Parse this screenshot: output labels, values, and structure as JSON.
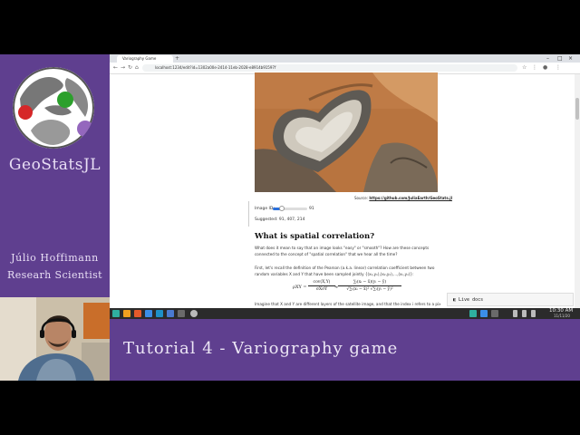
{
  "sidebar": {
    "brand": "GeoStatsJL",
    "presenter_name": "Júlio Hoffimann",
    "presenter_role": "Researh Scientist",
    "logo_colors": {
      "red": "#d62728",
      "green": "#2ca02c",
      "purple": "#9467bd"
    }
  },
  "footer": {
    "title": "Tutorial 4 - Variography game"
  },
  "browser": {
    "tab_label": "Variography Game",
    "url": "localhost:1234/edit?id=1302a00e-2414-11eb-2028-e8914b91597f",
    "window_controls": [
      "–",
      "□",
      "×"
    ],
    "new_tab_label": "+",
    "nav_icons": [
      "back-icon",
      "forward-icon",
      "reload-icon",
      "home-icon"
    ]
  },
  "page": {
    "source_prefix": "Source:",
    "source_link": "https://github.com/JuliaEarth/GeoStats.jl",
    "slider_label": "Image ID:",
    "slider_value": "91",
    "slider_level": 0.25,
    "suggested": "Suggested: 91, 407, 214",
    "heading": "What is spatial correlation?",
    "para1": "What does it mean to say that an image looks \"easy\" or \"smooth\"? How are these concepts connected to the concept of \"spatial correlation\" that we hear all the time?",
    "para2": "First, let's recall the definition of the Pearson (a.k.a. linear) correlation coefficient between two random variables X and Y that have been sampled jointly {(x₁,y₁),(x₂,y₂),…,(xₙ,yₙ)}:",
    "formula_lhs": "ρXY =",
    "formula_mid_num": "cov(X,Y)",
    "formula_mid_den": "σXσY",
    "formula_eq": "≈",
    "formula_rhs_num": "∑ᵢ(xᵢ − x̄)(yᵢ − ȳ)",
    "formula_rhs_den": "√∑ᵢ(xᵢ − x̄)² √∑ᵢ(yᵢ − ȳ)²",
    "para3": "Imagine that X and Y are different layers of the satellite image, and that the index i refers to a pixel",
    "live_docs": "Live docs"
  },
  "taskbar": {
    "time": "10:30 AM",
    "date": "11/11/20",
    "icon_colors": [
      "#2fb0a0",
      "#f0a020",
      "#e55a2b",
      "#3b8ee8",
      "#1e90c8",
      "#4a7ad0",
      "#6a6a6a",
      "#bbbbbb"
    ]
  }
}
